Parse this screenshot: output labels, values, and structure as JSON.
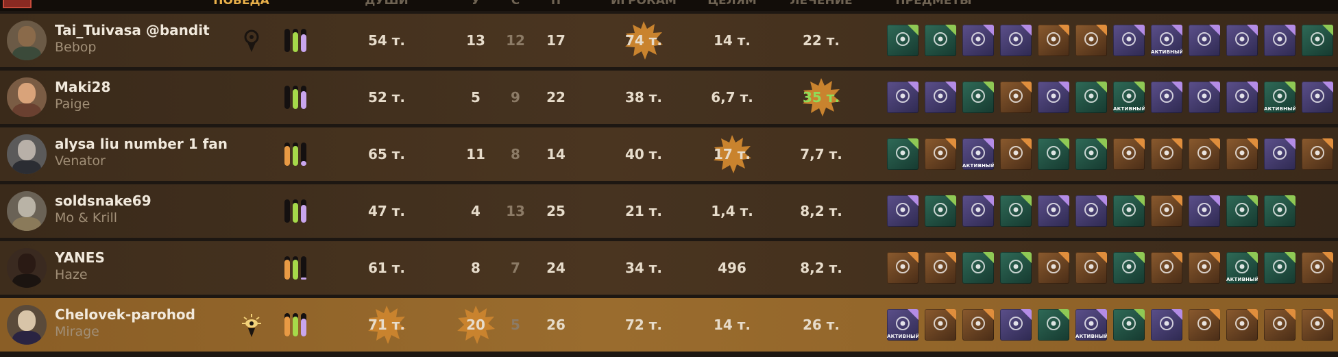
{
  "header": {
    "labels": [
      "ПОБЕДА",
      "ДУШИ",
      "У",
      "С",
      "П",
      "ИГРОКАМ",
      "ЦЕЛЯМ",
      "ЛЕЧЕНИЕ",
      "ПРЕДМЕТЫ"
    ]
  },
  "colors": {
    "accent": "#e9b04a",
    "badge_orange": "#c9832e",
    "heal_green": "#8fdc59",
    "vitality": "#8fc955",
    "spirit": "#b48ce6",
    "weapon": "#e08e3c"
  },
  "players": [
    {
      "name": "Tai_Tuivasa @bandit",
      "hero": "Bebop",
      "role_icon": "keyhole-eye-icon",
      "bars": [
        0.0,
        0.85,
        0.75
      ],
      "souls": "54 т.",
      "kills": "13",
      "deaths": "12",
      "assists": "17",
      "player_dmg": "74 т.",
      "obj_dmg": "14 т.",
      "healing": "22 т.",
      "badges": [
        "player_dmg"
      ],
      "items": [
        {
          "type": "vit",
          "icon": "heart-icon",
          "active": false
        },
        {
          "type": "vit",
          "icon": "fangs-icon",
          "active": false
        },
        {
          "type": "spirit",
          "icon": "eye-totem-icon",
          "active": false
        },
        {
          "type": "spirit",
          "icon": "cross-eye-icon",
          "active": false
        },
        {
          "type": "weapon",
          "icon": "hand-heart-icon",
          "active": false
        },
        {
          "type": "weapon",
          "icon": "lion-icon",
          "active": false
        },
        {
          "type": "spirit",
          "icon": "serpent-icon",
          "active": false
        },
        {
          "type": "spirit",
          "icon": "crystal-icon",
          "active": true
        },
        {
          "type": "spirit",
          "icon": "claw-burst-icon",
          "active": false
        },
        {
          "type": "spirit",
          "icon": "waves-icon",
          "active": false
        },
        {
          "type": "spirit",
          "icon": "flame-drop-icon",
          "active": false
        },
        {
          "type": "vit",
          "icon": "pentagram-icon",
          "active": false
        }
      ]
    },
    {
      "name": "Maki28",
      "hero": "Paige",
      "role_icon": "",
      "bars": [
        0.0,
        0.85,
        0.75
      ],
      "souls": "52 т.",
      "kills": "5",
      "deaths": "9",
      "assists": "22",
      "player_dmg": "38 т.",
      "obj_dmg": "6,7 т.",
      "healing": "35 т.",
      "badges": [
        "healing"
      ],
      "items": [
        {
          "type": "spirit",
          "icon": "unicorn-icon",
          "active": false
        },
        {
          "type": "spirit",
          "icon": "figure-icon",
          "active": false
        },
        {
          "type": "vit",
          "icon": "goblin-icon",
          "active": false
        },
        {
          "type": "weapon",
          "icon": "bolt-hand-icon",
          "active": false
        },
        {
          "type": "spirit",
          "icon": "eye-totem-icon",
          "active": false
        },
        {
          "type": "vit",
          "icon": "demon-mask-icon",
          "active": false
        },
        {
          "type": "vit",
          "icon": "leaf-blade-icon",
          "active": true
        },
        {
          "type": "spirit",
          "icon": "cross-eye-icon",
          "active": false
        },
        {
          "type": "spirit",
          "icon": "vortex-icon",
          "active": false
        },
        {
          "type": "spirit",
          "icon": "eye-ring-icon",
          "active": false
        },
        {
          "type": "vit",
          "icon": "wings-icon",
          "active": true
        },
        {
          "type": "spirit",
          "icon": "claw-burst-icon",
          "active": false
        }
      ]
    },
    {
      "name": "alysa liu number 1 fan",
      "hero": "Venator",
      "role_icon": "",
      "bars": [
        0.85,
        0.85,
        0.2
      ],
      "souls": "65 т.",
      "kills": "11",
      "deaths": "8",
      "assists": "14",
      "player_dmg": "40 т.",
      "obj_dmg": "17 т.",
      "healing": "7,7 т.",
      "badges": [
        "obj_dmg"
      ],
      "items": [
        {
          "type": "vit",
          "icon": "runner-icon",
          "active": false
        },
        {
          "type": "weapon",
          "icon": "star-shard-icon",
          "active": false
        },
        {
          "type": "spirit",
          "icon": "orb-icon",
          "active": true
        },
        {
          "type": "weapon",
          "icon": "pillar-icon",
          "active": false
        },
        {
          "type": "vit",
          "icon": "gear-icon",
          "active": false
        },
        {
          "type": "vit",
          "icon": "figure-icon",
          "active": false
        },
        {
          "type": "weapon",
          "icon": "skull-icon",
          "active": false
        },
        {
          "type": "weapon",
          "icon": "burst-icon",
          "active": false
        },
        {
          "type": "weapon",
          "icon": "hand-icon",
          "active": false
        },
        {
          "type": "weapon",
          "icon": "mouth-icon",
          "active": false
        },
        {
          "type": "spirit",
          "icon": "eye-ring-icon",
          "active": false
        },
        {
          "type": "weapon",
          "icon": "sparkle-icon",
          "active": false
        }
      ]
    },
    {
      "name": "soldsnake69",
      "hero": "Mo & Krill",
      "role_icon": "",
      "bars": [
        0.0,
        0.85,
        0.75
      ],
      "souls": "47 т.",
      "kills": "4",
      "deaths": "13",
      "assists": "25",
      "player_dmg": "21 т.",
      "obj_dmg": "1,4 т.",
      "healing": "8,2 т.",
      "badges": [],
      "items": [
        {
          "type": "spirit",
          "icon": "compass-icon",
          "active": false
        },
        {
          "type": "vit",
          "icon": "coffin-icon",
          "active": false
        },
        {
          "type": "spirit",
          "icon": "magnet-icon",
          "active": false
        },
        {
          "type": "vit",
          "icon": "runner-icon",
          "active": false
        },
        {
          "type": "spirit",
          "icon": "fire-fist-icon",
          "active": false
        },
        {
          "type": "spirit",
          "icon": "hourglass-icon",
          "active": false
        },
        {
          "type": "vit",
          "icon": "figure-icon",
          "active": false
        },
        {
          "type": "weapon",
          "icon": "runner-icon",
          "active": false
        },
        {
          "type": "spirit",
          "icon": "eye-ring-icon",
          "active": false
        },
        {
          "type": "vit",
          "icon": "figure-icon",
          "active": false
        },
        {
          "type": "vit",
          "icon": "drum-icon",
          "active": false
        }
      ]
    },
    {
      "name": "YANES",
      "hero": "Haze",
      "role_icon": "",
      "bars": [
        0.85,
        0.85,
        0.1
      ],
      "souls": "61 т.",
      "kills": "8",
      "deaths": "7",
      "assists": "24",
      "player_dmg": "34 т.",
      "obj_dmg": "496",
      "healing": "8,2 т.",
      "badges": [],
      "items": [
        {
          "type": "weapon",
          "icon": "chart-icon",
          "active": false
        },
        {
          "type": "weapon",
          "icon": "arm-icon",
          "active": false
        },
        {
          "type": "vit",
          "icon": "pillar-icon",
          "active": false
        },
        {
          "type": "vit",
          "icon": "demon-mask-icon",
          "active": false
        },
        {
          "type": "weapon",
          "icon": "beast-icon",
          "active": false
        },
        {
          "type": "weapon",
          "icon": "claw-icon",
          "active": false
        },
        {
          "type": "vit",
          "icon": "figure-icon",
          "active": false
        },
        {
          "type": "weapon",
          "icon": "moon-icon",
          "active": false
        },
        {
          "type": "weapon",
          "icon": "skull-icon",
          "active": false
        },
        {
          "type": "vit",
          "icon": "burst-icon",
          "active": true
        },
        {
          "type": "vit",
          "icon": "flower-icon",
          "active": false
        },
        {
          "type": "weapon",
          "icon": "guitar-icon",
          "active": false
        }
      ]
    },
    {
      "name": "Chelovek-parohod",
      "hero": "Mirage",
      "role_icon": "radiant-eye-icon",
      "bars": [
        0.85,
        0.85,
        0.75
      ],
      "souls": "71 т.",
      "kills": "20",
      "deaths": "5",
      "assists": "26",
      "player_dmg": "72 т.",
      "obj_dmg": "14 т.",
      "healing": "26 т.",
      "badges": [
        "souls",
        "kills"
      ],
      "items": [
        {
          "type": "spirit",
          "icon": "wave-icon",
          "active": true
        },
        {
          "type": "weapon",
          "icon": "hand-heart-icon",
          "active": false
        },
        {
          "type": "weapon",
          "icon": "blades-icon",
          "active": false
        },
        {
          "type": "spirit",
          "icon": "serpent-icon",
          "active": false
        },
        {
          "type": "vit",
          "icon": "hand-icon",
          "active": false
        },
        {
          "type": "spirit",
          "icon": "crystal-icon",
          "active": true
        },
        {
          "type": "vit",
          "icon": "pentagram-icon",
          "active": false
        },
        {
          "type": "spirit",
          "icon": "claw-burst-icon",
          "active": false
        },
        {
          "type": "weapon",
          "icon": "fists-icon",
          "active": false
        },
        {
          "type": "weapon",
          "icon": "sparkle-icon",
          "active": false
        },
        {
          "type": "weapon",
          "icon": "bell-icon",
          "active": false
        },
        {
          "type": "weapon",
          "icon": "mouth-icon",
          "active": false
        }
      ]
    }
  ],
  "labels": {
    "active_tag": "АКТИВНЫЙ"
  }
}
